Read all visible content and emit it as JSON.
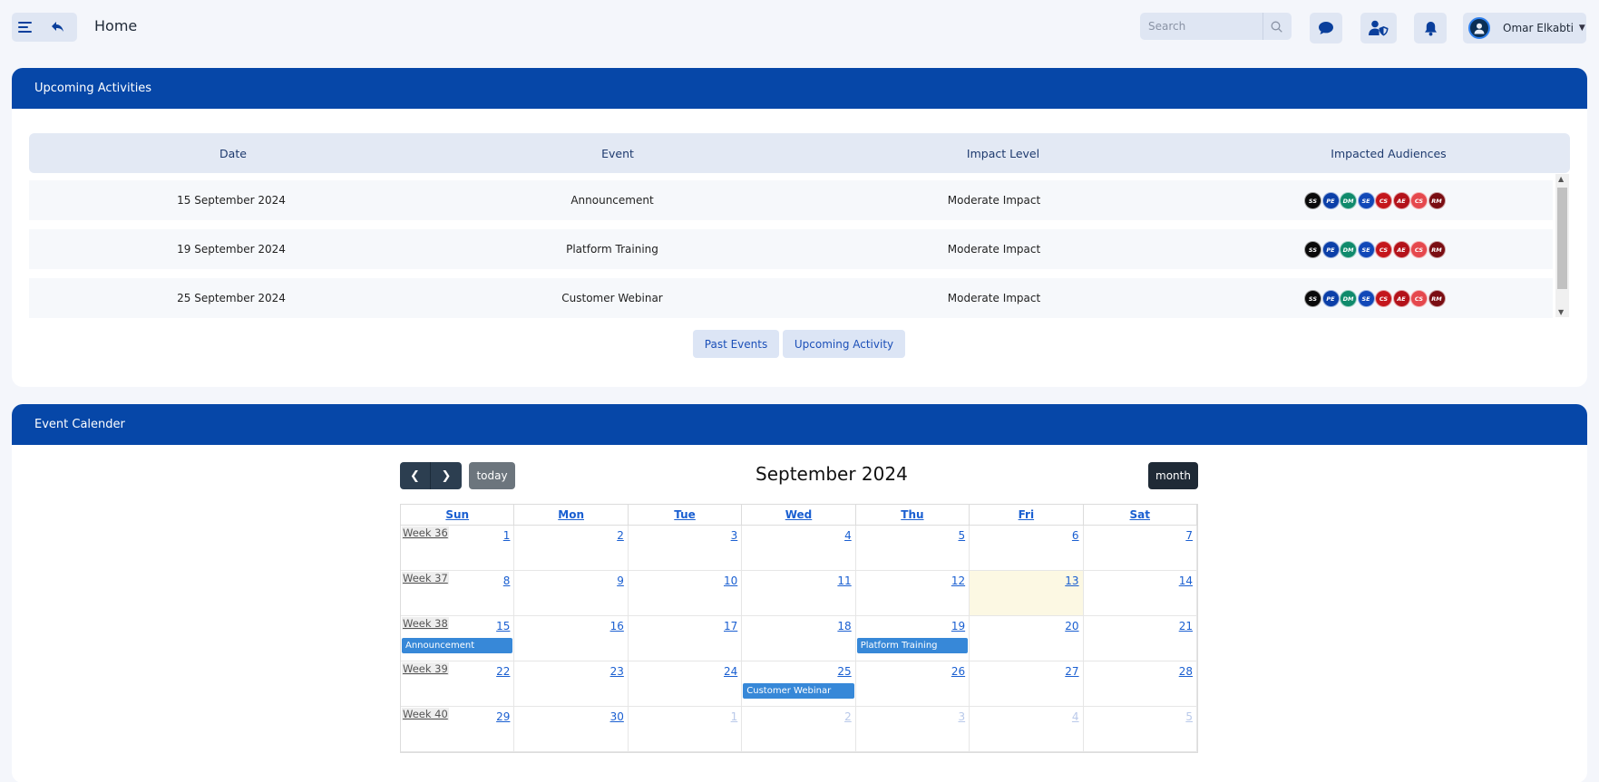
{
  "header": {
    "title": "Home",
    "search_placeholder": "Search",
    "user_name": "Omar Elkabti"
  },
  "activities": {
    "title": "Upcoming Activities",
    "columns": [
      "Date",
      "Event",
      "Impact Level",
      "Impacted Audiences"
    ],
    "rows": [
      {
        "date": "15 September 2024",
        "event": "Announcement",
        "impact": "Moderate Impact"
      },
      {
        "date": "19 September 2024",
        "event": "Platform Training",
        "impact": "Moderate Impact"
      },
      {
        "date": "25 September 2024",
        "event": "Customer Webinar",
        "impact": "Moderate Impact"
      }
    ],
    "audiences": [
      {
        "code": "SS",
        "color": "#0a0a0a"
      },
      {
        "code": "PE",
        "color": "#0b3fa8"
      },
      {
        "code": "DM",
        "color": "#0f8a6b"
      },
      {
        "code": "SE",
        "color": "#1148b8"
      },
      {
        "code": "CS",
        "color": "#c4161c"
      },
      {
        "code": "AE",
        "color": "#b3121a"
      },
      {
        "code": "CS",
        "color": "#e5484d"
      },
      {
        "code": "RM",
        "color": "#7a0d12"
      }
    ],
    "buttons": {
      "past": "Past Events",
      "upcoming": "Upcoming Activity"
    }
  },
  "calendar": {
    "section_title": "Event Calender",
    "title": "September 2024",
    "today_label": "today",
    "view_label": "month",
    "days": [
      "Sun",
      "Mon",
      "Tue",
      "Wed",
      "Thu",
      "Fri",
      "Sat"
    ],
    "weeks": [
      {
        "label": "Week 36",
        "days": [
          "1",
          "2",
          "3",
          "4",
          "5",
          "6",
          "7"
        ]
      },
      {
        "label": "Week 37",
        "days": [
          "8",
          "9",
          "10",
          "11",
          "12",
          "13",
          "14"
        ]
      },
      {
        "label": "Week 38",
        "days": [
          "15",
          "16",
          "17",
          "18",
          "19",
          "20",
          "21"
        ]
      },
      {
        "label": "Week 39",
        "days": [
          "22",
          "23",
          "24",
          "25",
          "26",
          "27",
          "28"
        ]
      },
      {
        "label": "Week 40",
        "days": [
          "29",
          "30",
          "1",
          "2",
          "3",
          "4",
          "5"
        ]
      }
    ],
    "events": [
      {
        "title": "Announcement",
        "week": 2,
        "day": 0
      },
      {
        "title": "Platform Training",
        "week": 2,
        "day": 4
      },
      {
        "title": "Customer Webinar",
        "week": 3,
        "day": 3
      }
    ]
  }
}
